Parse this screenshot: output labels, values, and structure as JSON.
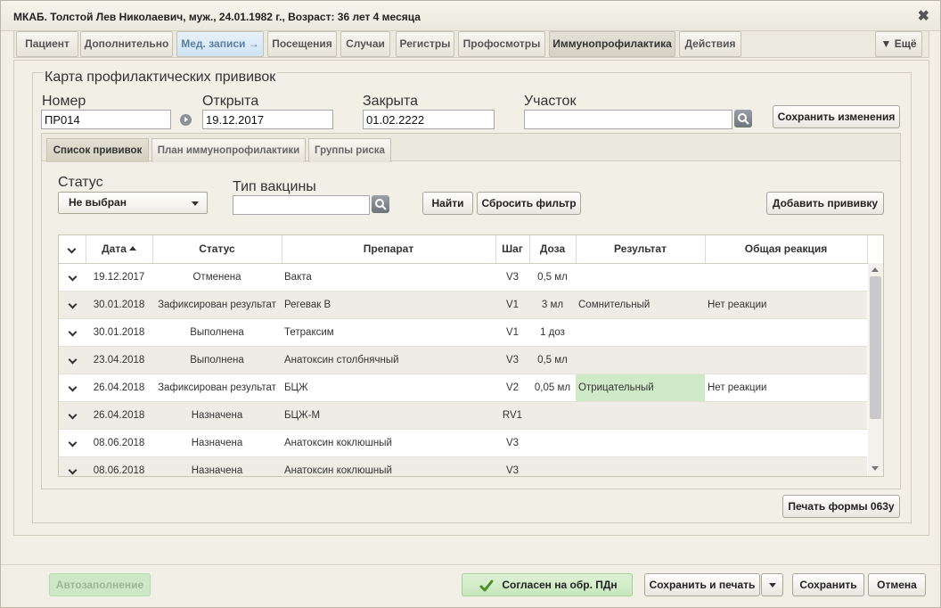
{
  "window": {
    "title": "МКАБ. Толстой Лев Николаевич, муж., 24.01.1982 г., Возраст: 36 лет 4 месяца",
    "close_glyph": "✖"
  },
  "top_tabs": {
    "patient": "Пациент",
    "additional": "Дополнительно",
    "med_records": "Мед. записи →",
    "visits": "Посещения",
    "cases": "Случаи",
    "registers": "Регистры",
    "checkups": "Профосмотры",
    "immuno": "Иммунопрофилактика",
    "actions": "Действия",
    "more": "▼ Ещё"
  },
  "card": {
    "legend": "Карта профилактических прививок",
    "number_label": "Номер",
    "number_value": "ПР014",
    "opened_label": "Открыта",
    "opened_value": "19.12.2017",
    "closed_label": "Закрыта",
    "closed_value": "01.02.2222",
    "district_label": "Участок",
    "district_value": "",
    "save_changes": "Сохранить изменения"
  },
  "sub_tabs": {
    "list": "Список прививок",
    "plan": "План иммунопрофилактики",
    "risk": "Группы риска"
  },
  "filter": {
    "status_label": "Статус",
    "status_value": "Не выбран",
    "vaccine_type_label": "Тип вакцины",
    "vaccine_type_value": "",
    "find": "Найти",
    "reset": "Сбросить фильтр",
    "add": "Добавить прививку"
  },
  "table": {
    "columns": {
      "date": "Дата",
      "status": "Статус",
      "drug": "Препарат",
      "step": "Шаг",
      "dose": "Доза",
      "result": "Результат",
      "reaction": "Общая реакция"
    },
    "rows": [
      {
        "date": "19.12.2017",
        "status": "Отменена",
        "drug": "Вакта",
        "step": "V3",
        "dose": "0,5 мл",
        "result": "",
        "reaction": ""
      },
      {
        "date": "30.01.2018",
        "status": "Зафиксирован результат",
        "drug": "Регевак В",
        "step": "V1",
        "dose": "3 мл",
        "result": "Сомнительный",
        "reaction": "Нет реакции"
      },
      {
        "date": "30.01.2018",
        "status": "Выполнена",
        "drug": "Тетраксим",
        "step": "V1",
        "dose": "1 доз",
        "result": "",
        "reaction": ""
      },
      {
        "date": "23.04.2018",
        "status": "Выполнена",
        "drug": "Анатоксин столбнячный",
        "step": "V3",
        "dose": "0,5 мл",
        "result": "",
        "reaction": ""
      },
      {
        "date": "26.04.2018",
        "status": "Зафиксирован результат",
        "drug": "БЦЖ",
        "step": "V2",
        "dose": "0,05 мл",
        "result": "Отрицательный",
        "reaction": "Нет реакции"
      },
      {
        "date": "26.04.2018",
        "status": "Назначена",
        "drug": "БЦЖ-М",
        "step": "RV1",
        "dose": "",
        "result": "",
        "reaction": ""
      },
      {
        "date": "08.06.2018",
        "status": "Назначена",
        "drug": "Анатоксин коклюшный",
        "step": "V3",
        "dose": "",
        "result": "",
        "reaction": ""
      },
      {
        "date": "08.06.2018",
        "status": "Назначена",
        "drug": "Анатоксин коклюшный",
        "step": "V3",
        "dose": "",
        "result": "",
        "reaction": ""
      }
    ]
  },
  "print_form": "Печать формы 063у",
  "footer": {
    "autofill": "Автозаполнение",
    "consent": "Согласен на обр. ПДн",
    "save_print": "Сохранить и печать",
    "save": "Сохранить",
    "cancel": "Отмена"
  },
  "colors": {
    "highlight_green": "#cfeac6",
    "tab_blue": "#cfe3f3",
    "check_green": "#4a8f2a"
  }
}
